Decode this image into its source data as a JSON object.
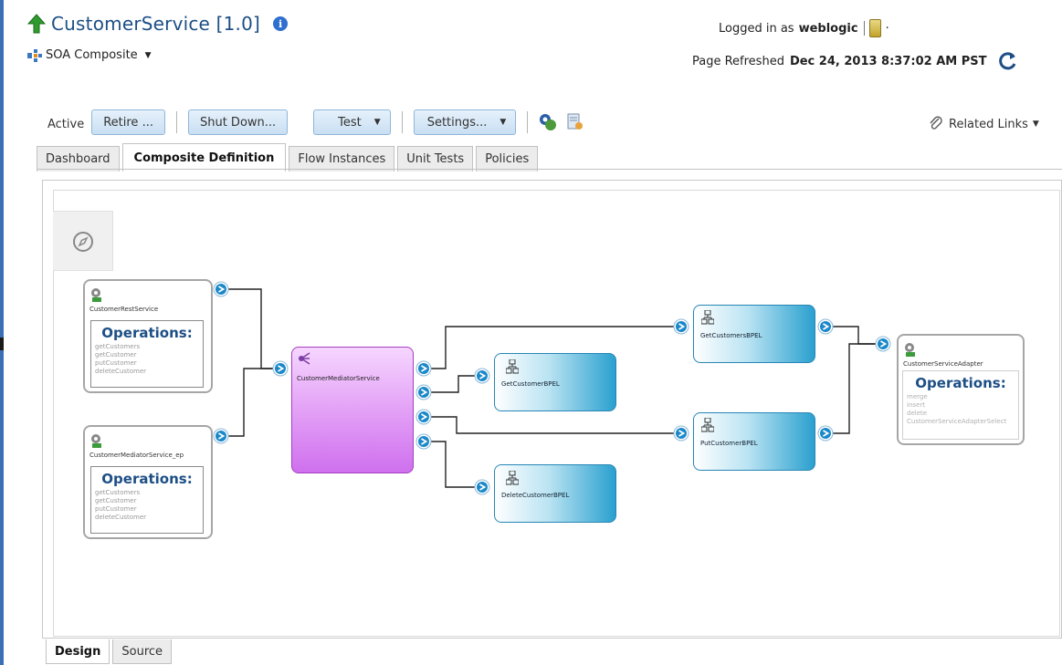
{
  "header": {
    "title": "CustomerService [1.0]",
    "info_icon": "i",
    "composite_type": "SOA Composite",
    "logged_in_prefix": "Logged in as",
    "user": "weblogic",
    "refreshed_prefix": "Page Refreshed",
    "refreshed_time": "Dec 24, 2013 8:37:02 AM PST"
  },
  "toolbar": {
    "state_label": "Active",
    "retire": "Retire ...",
    "shutdown": "Shut Down...",
    "test": "Test",
    "settings": "Settings...",
    "related_links": "Related Links"
  },
  "tabs": [
    "Dashboard",
    "Composite Definition",
    "Flow Instances",
    "Unit Tests",
    "Policies"
  ],
  "active_tab": "Composite Definition",
  "bottom_tabs": [
    "Design",
    "Source"
  ],
  "active_bottom_tab": "Design",
  "diagram": {
    "services": [
      {
        "name": "CustomerRestService",
        "ops_title": "Operations:",
        "operations": [
          "getCustomers",
          "getCustomer",
          "putCustomer",
          "deleteCustomer"
        ]
      },
      {
        "name": "CustomerMediatorService_ep",
        "ops_title": "Operations:",
        "operations": [
          "getCustomers",
          "getCustomer",
          "putCustomer",
          "deleteCustomer"
        ]
      }
    ],
    "mediator": "CustomerMediatorService",
    "components": [
      "GetCustomerBPEL",
      "DeleteCustomerBPEL",
      "GetCustomersBPEL",
      "PutCustomerBPEL"
    ],
    "reference": {
      "name": "CustomerServiceAdapter",
      "ops_title": "Operations:",
      "operations": [
        "merge",
        "insert",
        "delete",
        "CustomerServiceAdapterSelect"
      ]
    }
  },
  "icons": {
    "title": "green-up-arrow-icon",
    "composite": "soa-composite-icon",
    "refresh": "refresh-icon",
    "related": "paperclip-icon",
    "compass": "compass-icon",
    "gear": "gear-icon",
    "bpel": "bpel-process-icon",
    "mediator": "mediator-icon"
  },
  "colors": {
    "title": "#1d4f86",
    "button_bg": "#c9dff3",
    "bpel_blue": "#2aa0cf",
    "mediator_purple": "#cf70ee",
    "wire_port": "#1a88c9"
  }
}
